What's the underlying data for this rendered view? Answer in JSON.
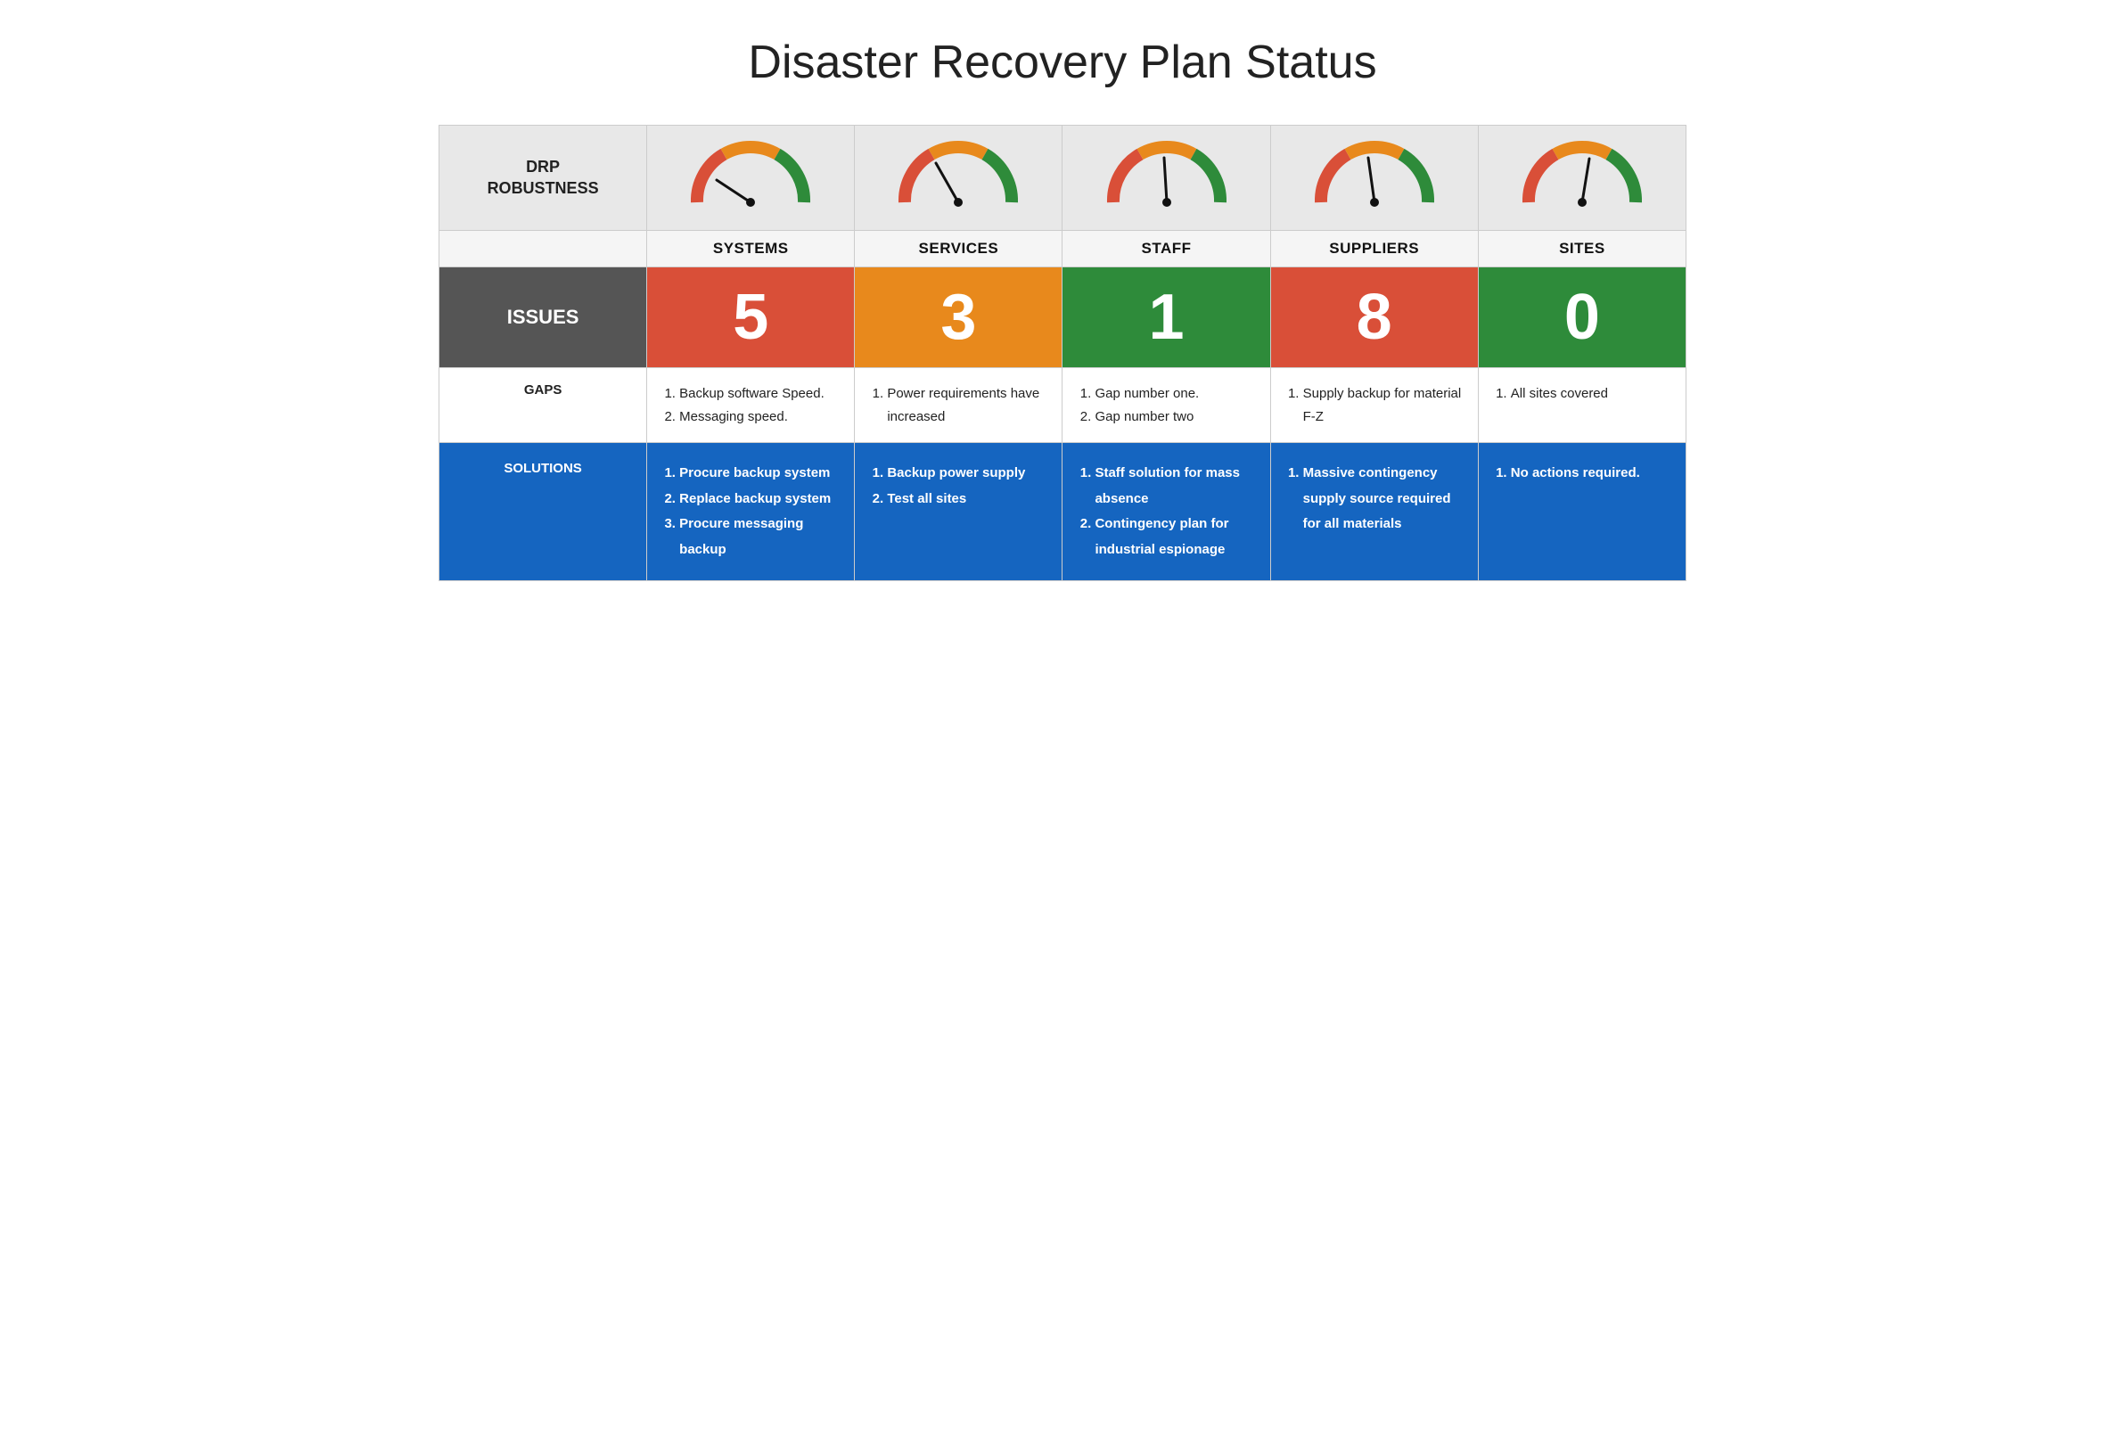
{
  "title": "Disaster Recovery Plan Status",
  "drp_label": "DRP\nROBUSTNESS",
  "columns": [
    "SYSTEMS",
    "SERVICES",
    "STAFF",
    "SUPPLIERS",
    "SITES"
  ],
  "gauges": [
    {
      "needle_angle": 215,
      "id": "systems"
    },
    {
      "needle_angle": 240,
      "id": "services"
    },
    {
      "needle_angle": 260,
      "id": "staff"
    },
    {
      "needle_angle": 255,
      "id": "suppliers"
    },
    {
      "needle_angle": 268,
      "id": "sites"
    }
  ],
  "issues": {
    "label": "ISSUES",
    "values": [
      {
        "number": "5",
        "color_class": "issue-red"
      },
      {
        "number": "3",
        "color_class": "issue-orange"
      },
      {
        "number": "1",
        "color_class": "issue-green"
      },
      {
        "number": "8",
        "color_class": "issue-red"
      },
      {
        "number": "0",
        "color_class": "issue-green"
      }
    ]
  },
  "gaps": {
    "label": "GAPS",
    "items": [
      [
        "Backup software Speed.",
        "Messaging speed."
      ],
      [
        "Power requirements have increased"
      ],
      [
        "Gap number one.",
        "Gap number two"
      ],
      [
        "Supply backup for material F-Z"
      ],
      [
        "All sites covered"
      ]
    ]
  },
  "solutions": {
    "label": "SOLUTIONS",
    "items": [
      [
        "Procure backup system",
        "Replace backup system",
        "Procure messaging backup"
      ],
      [
        "Backup power supply",
        "Test all sites"
      ],
      [
        "Staff solution for mass absence",
        "Contingency plan for industrial espionage"
      ],
      [
        "Massive contingency supply source required for all materials"
      ],
      [
        "No actions required."
      ]
    ]
  }
}
